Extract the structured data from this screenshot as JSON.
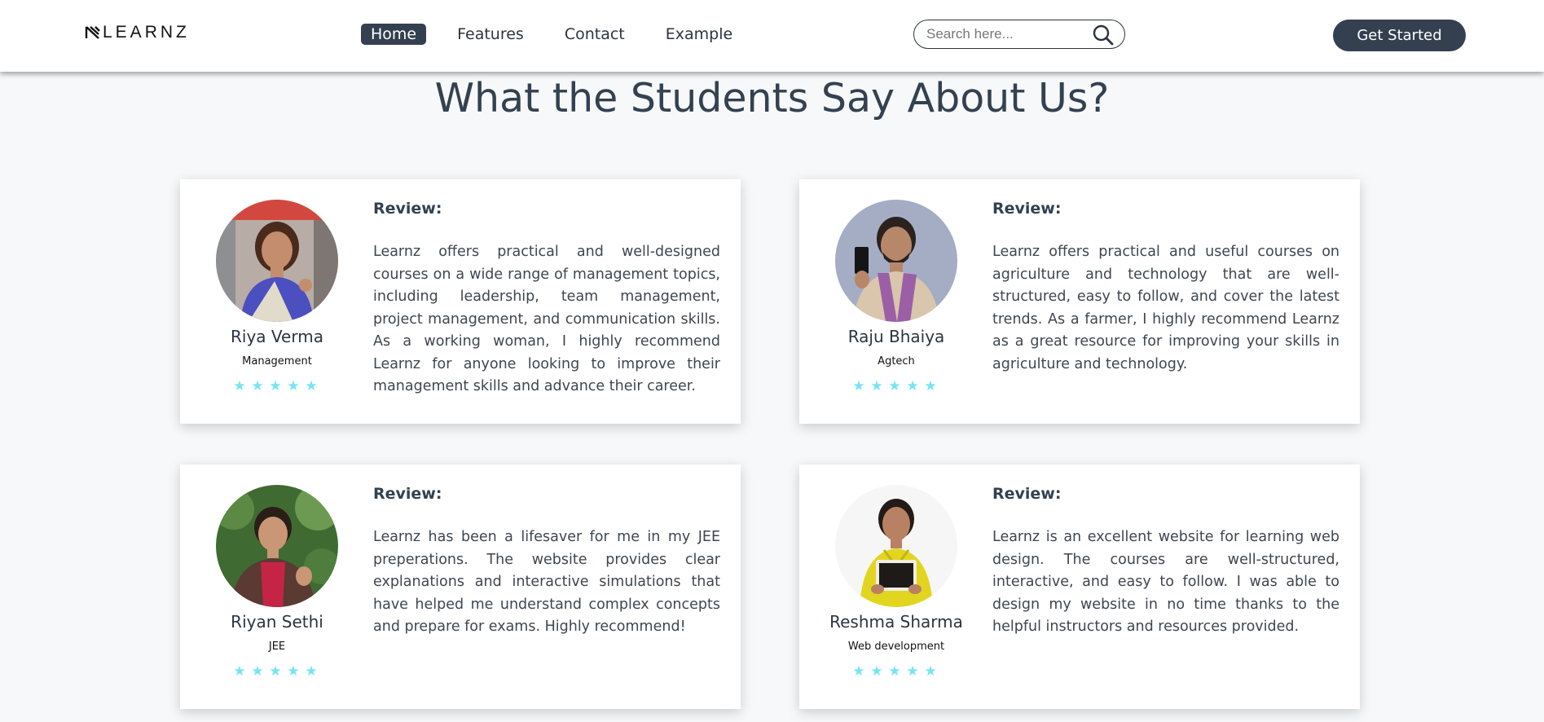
{
  "nav": {
    "logo_text": "LEARNZ",
    "links": [
      "Home",
      "Features",
      "Contact",
      "Example"
    ],
    "search_placeholder": "Search here...",
    "cta_label": "Get Started"
  },
  "section": {
    "title": "What the Students Say About Us?"
  },
  "colors": {
    "primary": "#344050",
    "star": "#76e4f4",
    "background": "#f7f8f9"
  },
  "testimonials": [
    {
      "name": "Riya Verma",
      "role": "Management",
      "review_label": "Review:",
      "review": "Learnz offers practical and well-designed courses on a wide range of management topics, including leadership, team management, project management, and communication skills. As a working woman, I highly recommend Learnz for anyone looking to improve their management skills and advance their career.",
      "rating": 5
    },
    {
      "name": "Raju Bhaiya",
      "role": "Agtech",
      "review_label": "Review:",
      "review": "Learnz offers practical and useful courses on agriculture and technology that are well-structured, easy to follow, and cover the latest trends. As a farmer, I highly recommend Learnz as a great resource for improving your skills in agriculture and technology.",
      "rating": 5
    },
    {
      "name": "Riyan Sethi",
      "role": "JEE",
      "review_label": "Review:",
      "review": "Learnz has been a lifesaver for me in my JEE preperations. The website provides clear explanations and interactive simulations that have helped me understand complex concepts and prepare for exams. Highly recommend!",
      "rating": 5
    },
    {
      "name": "Reshma Sharma",
      "role": "Web development",
      "review_label": "Review:",
      "review": "Learnz is an excellent website for learning web design. The courses are well-structured, interactive, and easy to follow. I was able to design my website in no time thanks to the helpful instructors and resources provided.",
      "rating": 5
    }
  ]
}
